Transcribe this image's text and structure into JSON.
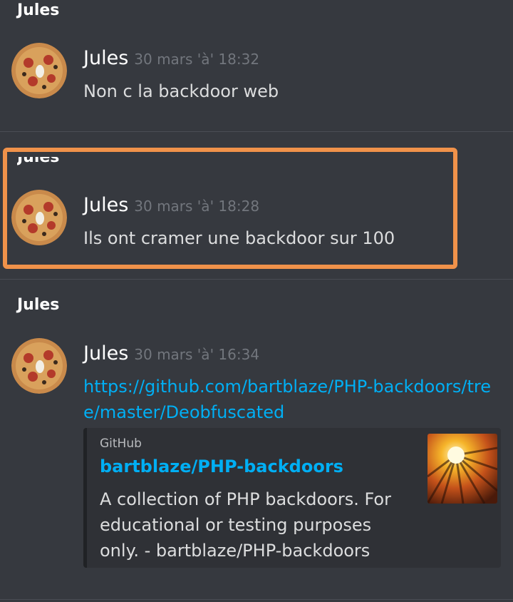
{
  "messages": [
    {
      "group_header": "Jules",
      "author": "Jules",
      "timestamp": "30 mars 'à' 18:32",
      "text": "Non c la backdoor web"
    },
    {
      "group_header": "Jules",
      "author": "Jules",
      "timestamp": "30 mars 'à' 18:28",
      "text": "Ils ont cramer une backdoor sur 100",
      "highlighted": true,
      "highlight_color": "#f0924a"
    },
    {
      "group_header": "Jules",
      "author": "Jules",
      "timestamp": "30 mars 'à' 16:34",
      "link": "https://github.com/bartblaze/PHP-backdoors/tree/master/Deobfuscated",
      "embed": {
        "provider": "GitHub",
        "title": "bartblaze/PHP-backdoors",
        "description": "A collection of PHP backdoors. For educational or testing purposes only. - bartblaze/PHP-backdoors",
        "thumbnail_icon": "sunburst-image"
      }
    }
  ],
  "colors": {
    "background": "#36393f",
    "link": "#00aff4",
    "timestamp": "#72767d",
    "embed_bg": "#2f3136"
  }
}
